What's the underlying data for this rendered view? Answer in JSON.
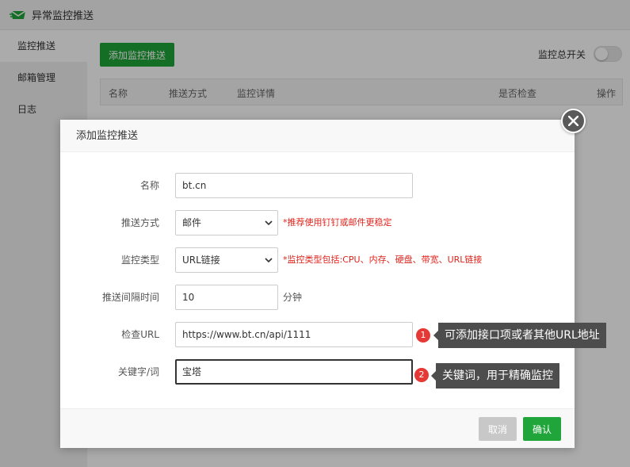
{
  "window": {
    "title": "异常监控推送"
  },
  "sidebar": {
    "items": [
      {
        "label": "监控推送"
      },
      {
        "label": "邮箱管理"
      },
      {
        "label": "日志"
      }
    ]
  },
  "main": {
    "add_button": "添加监控推送",
    "master_switch_label": "监控总开关",
    "master_switch_on": false,
    "table_headers": [
      "名称",
      "推送方式",
      "监控详情",
      "是否检查",
      "操作"
    ]
  },
  "modal": {
    "title": "添加监控推送",
    "fields": {
      "name": {
        "label": "名称",
        "value": "bt.cn"
      },
      "push_method": {
        "label": "推送方式",
        "value": "邮件",
        "hint": "*推荐使用钉钉或邮件更稳定"
      },
      "monitor_type": {
        "label": "监控类型",
        "value": "URL链接",
        "hint": "*监控类型包括:CPU、内存、硬盘、带宽、URL链接"
      },
      "interval": {
        "label": "推送间隔时间",
        "value": "10",
        "unit": "分钟"
      },
      "check_url": {
        "label": "检查URL",
        "value": "https://www.bt.cn/api/1111"
      },
      "keyword": {
        "label": "关键字/词",
        "value": "宝塔"
      }
    },
    "cancel_label": "取消",
    "confirm_label": "确认"
  },
  "annotations": [
    {
      "number": "1",
      "text": "可添加接口项或者其他URL地址"
    },
    {
      "number": "2",
      "text": "关键词，用于精确监控"
    }
  ],
  "colors": {
    "primary_green": "#20a53a",
    "hint_red": "#e0231b",
    "badge_red": "#e53935",
    "tooltip_bg": "#4d4d4d"
  },
  "icons": {
    "logo": "envelope-send-icon",
    "close": "close-icon",
    "select": "chevron-down-icon"
  }
}
